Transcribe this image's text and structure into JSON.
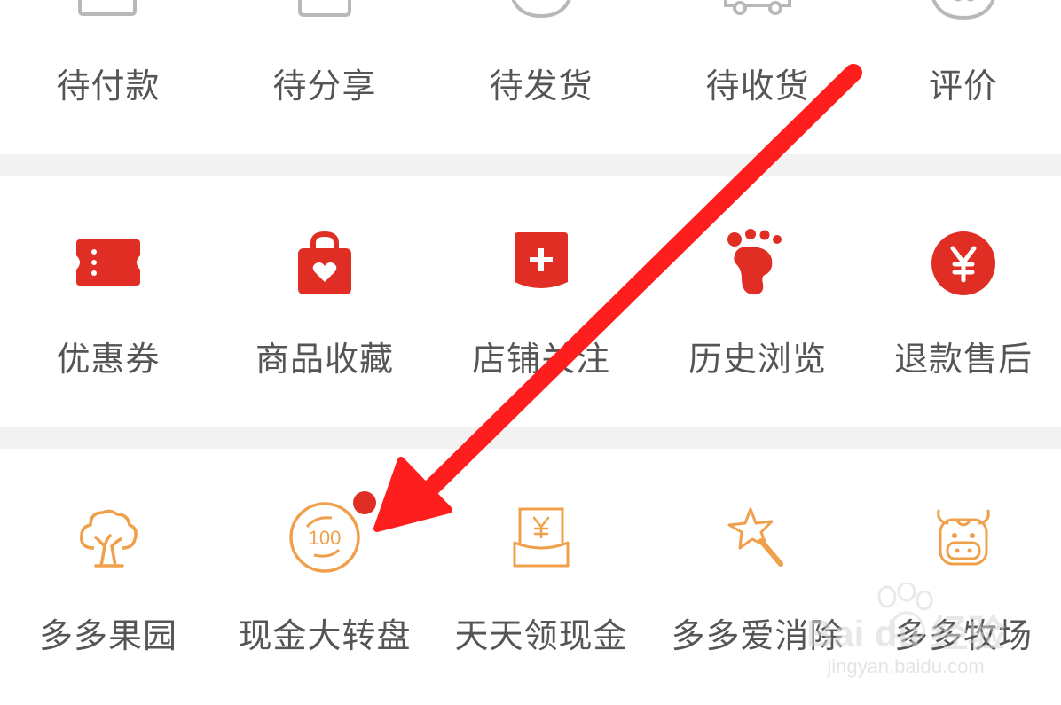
{
  "orders": {
    "items": [
      {
        "label": "待付款",
        "icon": "wallet-icon"
      },
      {
        "label": "待分享",
        "icon": "share-bag-icon"
      },
      {
        "label": "待发货",
        "icon": "package-icon"
      },
      {
        "label": "待收货",
        "icon": "truck-icon"
      },
      {
        "label": "评价",
        "icon": "comment-icon"
      }
    ]
  },
  "services": {
    "items": [
      {
        "label": "优惠券",
        "icon": "coupon-icon"
      },
      {
        "label": "商品收藏",
        "icon": "heart-bag-icon"
      },
      {
        "label": "店铺关注",
        "icon": "store-plus-icon"
      },
      {
        "label": "历史浏览",
        "icon": "footprint-icon"
      },
      {
        "label": "退款售后",
        "icon": "yuan-circle-icon"
      }
    ]
  },
  "activities": {
    "items": [
      {
        "label": "多多果园",
        "icon": "tree-icon"
      },
      {
        "label": "现金大转盘",
        "icon": "wheel-100-icon",
        "badge": true
      },
      {
        "label": "天天领现金",
        "icon": "cash-envelope-icon"
      },
      {
        "label": "多多爱消除",
        "icon": "star-wand-icon"
      },
      {
        "label": "多多牧场",
        "icon": "cow-icon"
      }
    ]
  },
  "watermark": {
    "brand": "Bai du 经验",
    "url": "jingyan.baidu.com"
  },
  "colors": {
    "accent_red": "#e02e24",
    "accent_orange": "#f0a04b",
    "arrow_red": "#ff1e1e",
    "text": "#555555",
    "icon_gray": "#b8b8b8"
  }
}
